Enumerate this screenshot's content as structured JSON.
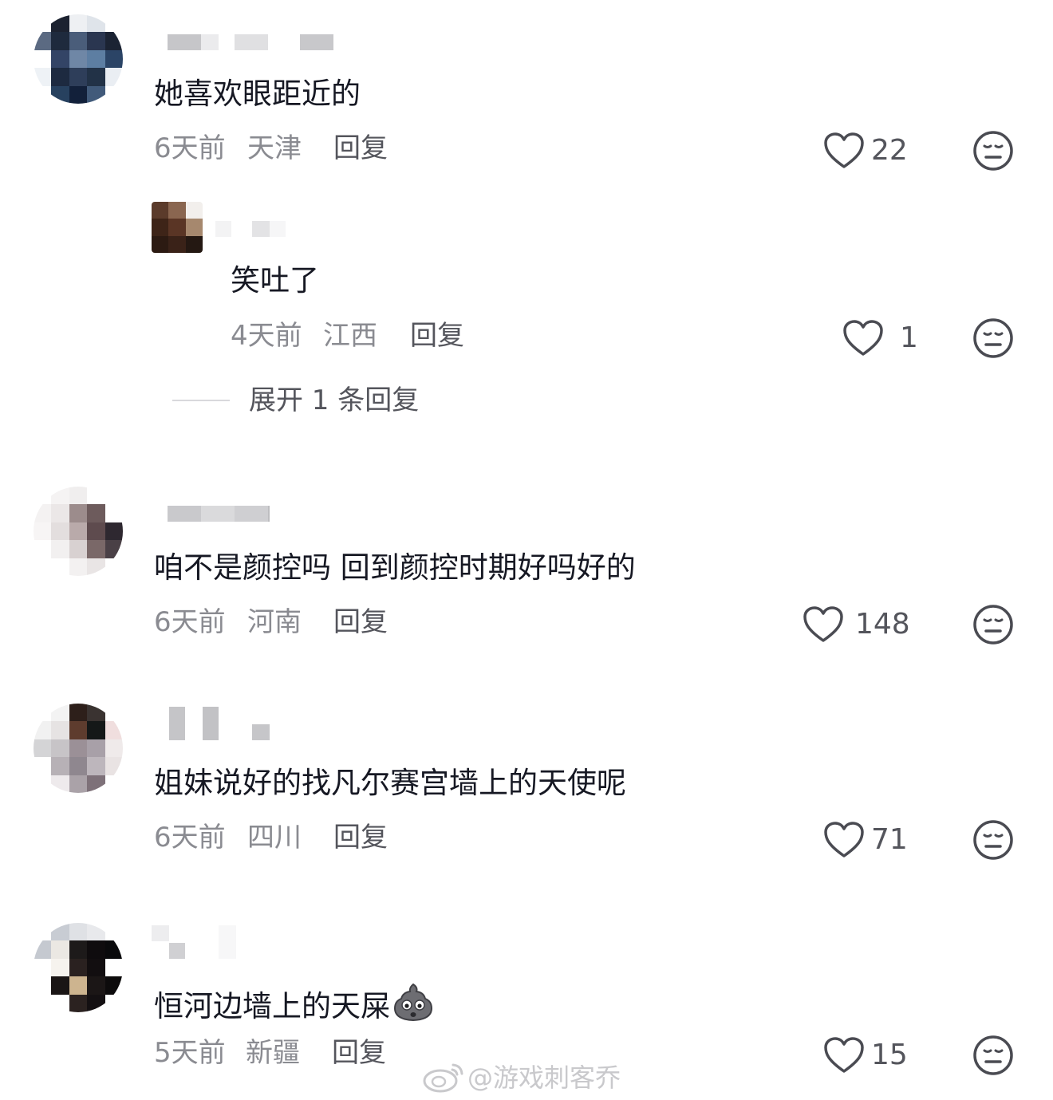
{
  "comments": [
    {
      "text": "她喜欢眼距近的",
      "time": "6天前",
      "location": "天津",
      "reply_label": "回复",
      "likes": "22",
      "replies": [
        {
          "text": "笑吐了",
          "time": "4天前",
          "location": "江西",
          "reply_label": "回复",
          "likes": "1"
        }
      ],
      "expand_label": "展开 1 条回复"
    },
    {
      "text": "咱不是颜控吗 回到颜控时期好吗好的",
      "time": "6天前",
      "location": "河南",
      "reply_label": "回复",
      "likes": "148"
    },
    {
      "text": "姐妹说好的找凡尔赛宫墙上的天使呢",
      "time": "6天前",
      "location": "四川",
      "reply_label": "回复",
      "likes": "71"
    },
    {
      "text": "恒河边墙上的天屎",
      "emoji": "poop-emoji",
      "time": "5天前",
      "location": "新疆",
      "reply_label": "回复",
      "likes": "15"
    }
  ],
  "watermark": "@游戏刺客乔",
  "icons": {
    "like": "heart-outline-icon",
    "reaction": "meh-face-icon",
    "watermark": "weibo-logo-icon"
  },
  "colors": {
    "text_primary": "#161823",
    "text_secondary": "#8a8b91",
    "icon": "#4a4b52"
  }
}
